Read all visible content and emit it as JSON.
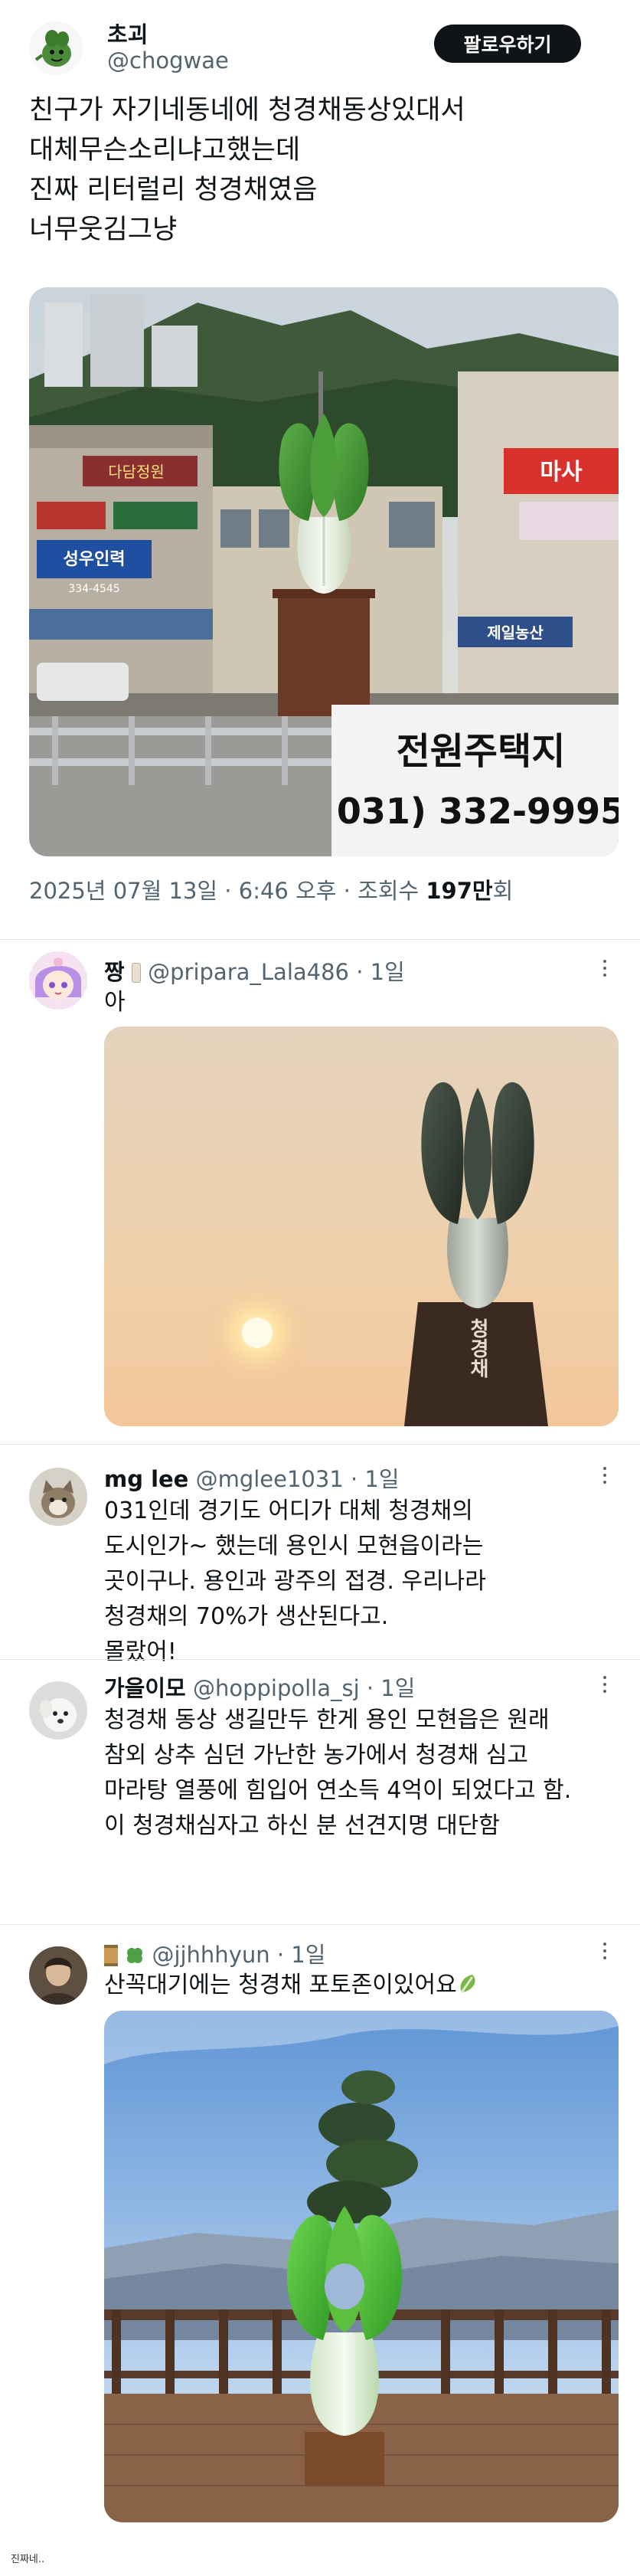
{
  "main_tweet": {
    "author_name": "초괴",
    "author_handle": "@chogwae",
    "follow_label": "팔로우하기",
    "text_lines": [
      "친구가 자기네동네에 청경채동상있대서",
      "대체무슨소리냐고했는데",
      "진짜 리터럴리 청경채였음",
      "너무웃김그냥"
    ],
    "photo_signs": {
      "realty": "전원주택지",
      "realty_phone": "031) 332-9995",
      "sign_1": "성우인력",
      "sign_1_phone": "334-4545",
      "sign_2": "마사",
      "sign_3": "제일농산",
      "sign_4": "다담정원"
    },
    "meta_prefix": "2025년 07월 13일 · 6:46 오후 · 조회수 ",
    "meta_views": "197만",
    "meta_suffix": "회"
  },
  "replies": [
    {
      "name": "짱",
      "handle": "@pripara_Lala486 · 1일",
      "lines": [
        "아"
      ],
      "photo_label": "청경채"
    },
    {
      "name": "mg lee",
      "handle": "@mglee1031 · 1일",
      "lines": [
        "031인데 경기도 어디가 대체 청경채의",
        "도시인가~ 했는데 용인시 모현읍이라는",
        "곳이구나. 용인과 광주의 접경. 우리나라",
        "청경채의 70%가 생산된다고.",
        "몰랐어!"
      ]
    },
    {
      "name": "가을이모",
      "handle": "@hoppipolla_sj · 1일",
      "lines": [
        "청경채 동상 생길만두 한게 용인 모현읍은 원래",
        "참외 상추 심던 가난한 농가에서 청경채 심고",
        "마라탕 열풍에 힘입어 연소득 4억이 되었다고 함.",
        "이 청경채심자고 하신 분 선견지명 대단함"
      ]
    },
    {
      "name": "",
      "handle": "@jjhhhyun · 1일",
      "lines": [
        "산꼭대기에는 청경채 포토존이있어요"
      ]
    }
  ],
  "footer_note": "진짜네..",
  "colors": {
    "text": "#0f1419",
    "secondary": "#536471",
    "divider": "#e4e8eb",
    "bokchoy_green": "#3f8f2f",
    "bokchoy_white": "#e9efe4"
  }
}
